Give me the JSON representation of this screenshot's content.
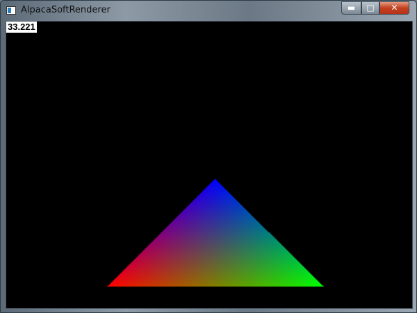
{
  "window": {
    "title": "AlpacaSoftRenderer",
    "minimize_glyph": "▬",
    "maximize_glyph": "□",
    "close_glyph": "✕"
  },
  "overlay": {
    "fps": "33.221"
  },
  "triangle": {
    "top_color": "#0000ff",
    "left_color": "#ff0000",
    "right_color": "#00ff00"
  }
}
